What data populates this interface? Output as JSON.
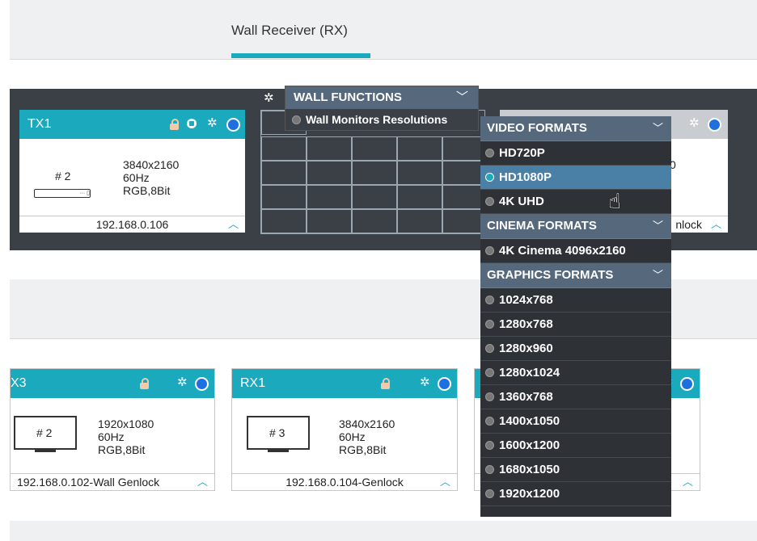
{
  "header": {
    "title": "Wall Receiver (RX)"
  },
  "tx_card": {
    "name": "TX1",
    "label": "# 2",
    "resolution": "3840x2160",
    "refresh": "60Hz",
    "color": "RGB,8Bit",
    "ip": "192.168.0.106"
  },
  "partial_card": {
    "res_fragment": "0",
    "footer_fragment": "nlock"
  },
  "wall_functions": {
    "title": "WALL FUNCTIONS",
    "item": "Wall Monitors Resolutions"
  },
  "format_menu": {
    "sections": [
      {
        "title": "VIDEO FORMATS",
        "options": [
          "HD720P",
          "HD1080P",
          "4K UHD"
        ]
      },
      {
        "title": "CINEMA FORMATS",
        "options": [
          "4K Cinema 4096x2160"
        ]
      },
      {
        "title": "GRAPHICS FORMATS",
        "options": [
          "1024x768",
          "1280x768",
          "1280x960",
          "1280x1024",
          "1360x768",
          "1400x1050",
          "1600x1200",
          "1680x1050",
          "1920x1200"
        ]
      }
    ],
    "selected": "HD1080P"
  },
  "rx_cards": [
    {
      "name": "X3",
      "label": "# 2",
      "resolution": "1920x1080",
      "refresh": "60Hz",
      "color": "RGB,8Bit",
      "ip": "192.168.0.102-Wall Genlock"
    },
    {
      "name": "RX1",
      "label": "# 3",
      "resolution": "3840x2160",
      "refresh": "60Hz",
      "color": "RGB,8Bit",
      "ip": "192.168.0.104-Genlock"
    }
  ],
  "colors": {
    "accent": "#1aa9bd",
    "dark": "#3b4047",
    "menu_header": "#56687c",
    "selected": "#4a7fa6",
    "status_blue": "#1e6fe0"
  },
  "icons": [
    "gear-icon",
    "lock-icon",
    "record-icon",
    "status-dot",
    "chevron-up-icon",
    "chevron-down-icon",
    "hand-cursor"
  ]
}
